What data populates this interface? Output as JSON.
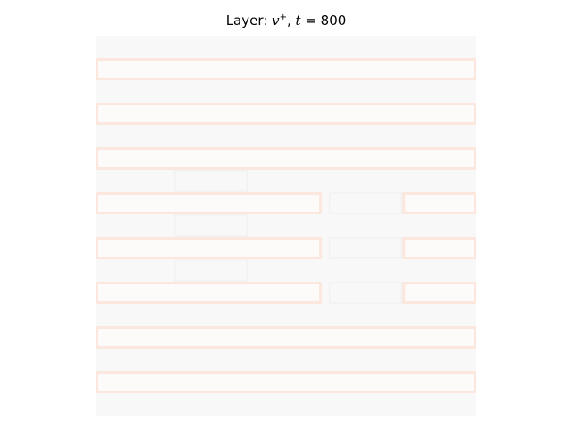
{
  "chart_data": {
    "type": "heatmap",
    "title": {
      "prefix": "Layer:",
      "var": "v",
      "superscript": "+",
      "time_var": "t",
      "time_value": "= 800"
    },
    "xlabel": "",
    "ylabel": "",
    "axes": "off",
    "colormap": "reds-light",
    "colors": {
      "background": "#f8f8f8",
      "stripe_fill": "#fcfbf9",
      "stripe_edge": "#fbe7dd",
      "faint_edge": "#f1f1f1"
    },
    "grid_size": [
      17,
      17
    ],
    "stripes": [
      {
        "row": 1,
        "segments": [
          [
            0,
            17
          ]
        ]
      },
      {
        "row": 3,
        "segments": [
          [
            0,
            17
          ]
        ]
      },
      {
        "row": 5,
        "segments": [
          [
            0,
            17
          ]
        ]
      },
      {
        "row": 7,
        "segments": [
          [
            0,
            10.1
          ],
          [
            13.7,
            17
          ]
        ]
      },
      {
        "row": 9,
        "segments": [
          [
            0,
            10.1
          ],
          [
            13.7,
            17
          ]
        ]
      },
      {
        "row": 11,
        "segments": [
          [
            0,
            10.1
          ],
          [
            13.7,
            17
          ]
        ]
      },
      {
        "row": 13,
        "segments": [
          [
            0,
            17
          ]
        ]
      },
      {
        "row": 15,
        "segments": [
          [
            0,
            17
          ]
        ]
      }
    ],
    "faint_regions": [
      {
        "row": 6,
        "col_range": [
          3.5,
          6.8
        ]
      },
      {
        "row": 8,
        "col_range": [
          3.5,
          6.8
        ]
      },
      {
        "row": 10,
        "col_range": [
          3.5,
          6.8
        ]
      },
      {
        "row": 7,
        "col_range": [
          10.4,
          13.7
        ]
      },
      {
        "row": 9,
        "col_range": [
          10.4,
          13.7
        ]
      },
      {
        "row": 11,
        "col_range": [
          10.4,
          13.7
        ]
      }
    ]
  }
}
